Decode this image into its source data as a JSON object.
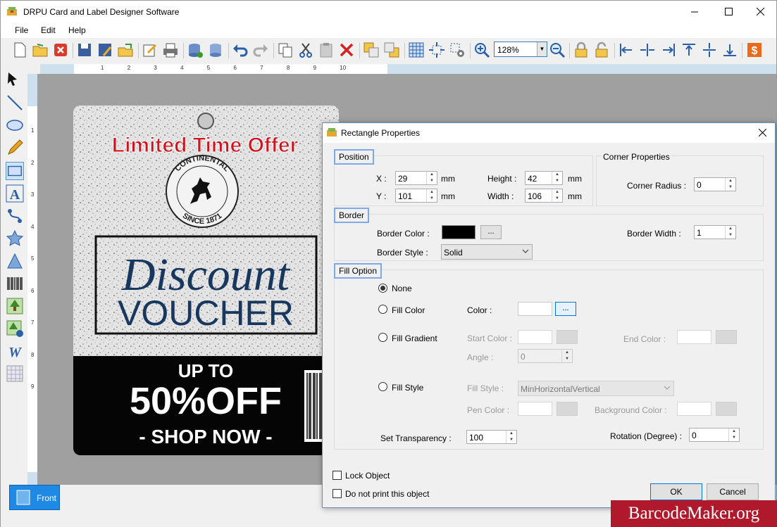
{
  "window": {
    "title": "DRPU Card and Label Designer Software",
    "minimize": "—",
    "maximize": "☐",
    "close": "✕"
  },
  "menu": [
    "File",
    "Edit",
    "Help"
  ],
  "toolbar": {
    "zoom": "128%"
  },
  "ruler": {
    "top_marks": [
      "1",
      "2",
      "3",
      "4",
      "5",
      "6",
      "7",
      "8",
      "9",
      "10"
    ],
    "left_marks": [
      "1",
      "2",
      "3",
      "4",
      "5",
      "6",
      "7",
      "8",
      "9"
    ]
  },
  "card": {
    "headline": "Limited Time Offer",
    "logo_top": "CONTINENTAL",
    "logo_bottom": "SINCE 1871",
    "script_word": "Discount",
    "block_word": "VOUCHER",
    "up_to": "UP TO",
    "percent": "50%OFF",
    "shop": "- SHOP NOW -"
  },
  "tab": {
    "label": "Front"
  },
  "dialog": {
    "title": "Rectangle Properties",
    "position": {
      "label": "Position",
      "x_label": "X :",
      "x": "29",
      "y_label": "Y :",
      "y": "101",
      "height_label": "Height :",
      "height": "42",
      "width_label": "Width :",
      "width": "106",
      "unit": "mm"
    },
    "corner": {
      "label": "Corner Properties",
      "radius_label": "Corner Radius :",
      "radius": "0"
    },
    "border": {
      "label": "Border",
      "color_label": "Border Color :",
      "color": "#000000",
      "width_label": "Border Width :",
      "width": "1",
      "style_label": "Border Style :",
      "style": "Solid",
      "browse": "..."
    },
    "fill": {
      "label": "Fill Option",
      "none": "None",
      "fill_color": "Fill Color",
      "color_label": "Color :",
      "fill_gradient": "Fill Gradient",
      "start_color": "Start Color :",
      "end_color": "End Color :",
      "angle_label": "Angle :",
      "angle": "0",
      "fill_style": "Fill Style",
      "fill_style_label": "Fill Style :",
      "fill_style_value": "MinHorizontalVertical",
      "pen_color": "Pen Color :",
      "bg_color": "Background Color :",
      "browse": "...",
      "selected": "None"
    },
    "transparency_label": "Set Transparency :",
    "transparency": "100",
    "rotation_label": "Rotation (Degree) :",
    "rotation": "0",
    "lock": "Lock Object",
    "noprint": "Do not print this object",
    "ok": "OK",
    "cancel": "Cancel"
  },
  "brand": "BarcodeMaker.org",
  "colors": {
    "accent": "#1e8ae6",
    "headline_red": "#d0141d",
    "voucher_blue": "#17375e",
    "brand_red": "#b0182c"
  }
}
